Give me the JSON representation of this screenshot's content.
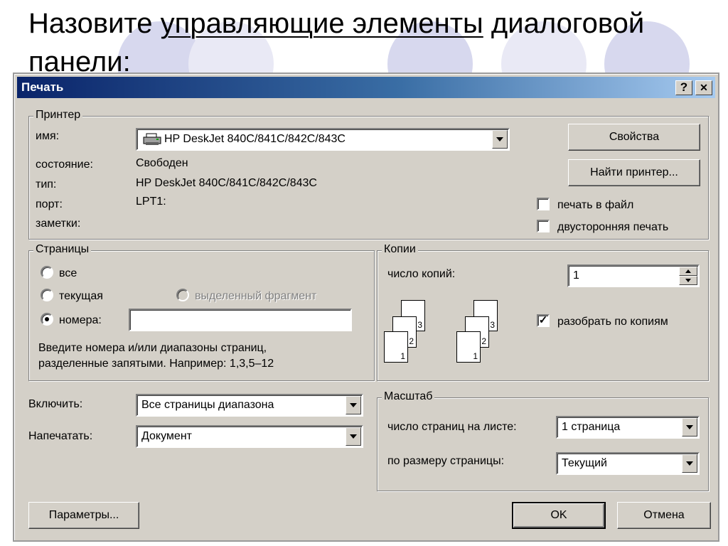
{
  "slide": {
    "title_part1": "Назовите ",
    "title_underlined": "управляющие элементы",
    "title_part2": " диалоговой панели:"
  },
  "dialog": {
    "title": "Печать",
    "help_button": "?",
    "close_button": "✕",
    "printer_group": {
      "label": "Принтер",
      "name_label": "имя:",
      "name_value": "HP DeskJet 840C/841C/842C/843C",
      "status_label": "состояние:",
      "status_value": "Свободен",
      "type_label": "тип:",
      "type_value": "HP DeskJet 840C/841C/842C/843C",
      "port_label": "порт:",
      "port_value": "LPT1:",
      "notes_label": "заметки:",
      "properties_button": "Свойства",
      "find_printer_button": "Найти принтер...",
      "print_to_file_label": "печать в файл",
      "print_to_file_checked": false,
      "duplex_label": "двусторонняя печать",
      "duplex_checked": false
    },
    "pages_group": {
      "label": "Страницы",
      "all_label": "все",
      "current_label": "текущая",
      "selection_label": "выделенный фрагмент",
      "numbers_label": "номера:",
      "selected_option": "номера:",
      "numbers_value": "",
      "hint_line1": "Введите номера и/или диапазоны страниц,",
      "hint_line2": "разделенные запятыми. Например: 1,3,5–12"
    },
    "copies_group": {
      "label": "Копии",
      "count_label": "число копий:",
      "count_value": "1",
      "collate_label": "разобрать по копиям",
      "collate_checked": true,
      "page_numbers": [
        "1",
        "2",
        "3"
      ]
    },
    "include_label": "Включить:",
    "include_value": "Все страницы диапазона",
    "print_what_label": "Напечатать:",
    "print_what_value": "Документ",
    "scale_group": {
      "label": "Масштаб",
      "pages_per_sheet_label": "число страниц на листе:",
      "pages_per_sheet_value": "1 страница",
      "fit_label": "по размеру страницы:",
      "fit_value": "Текущий"
    },
    "options_button": "Параметры...",
    "ok_button": "OK",
    "cancel_button": "Отмена"
  },
  "colors": {
    "dialog_face": "#d4d0c8",
    "titlebar_start": "#0a246a",
    "titlebar_end": "#a6caf0",
    "deco_circle": "#d7d8ee"
  },
  "icons": [
    "printer-icon",
    "help-icon",
    "close-icon",
    "chevron-down-icon",
    "spin-up-icon",
    "spin-down-icon",
    "check-icon"
  ]
}
